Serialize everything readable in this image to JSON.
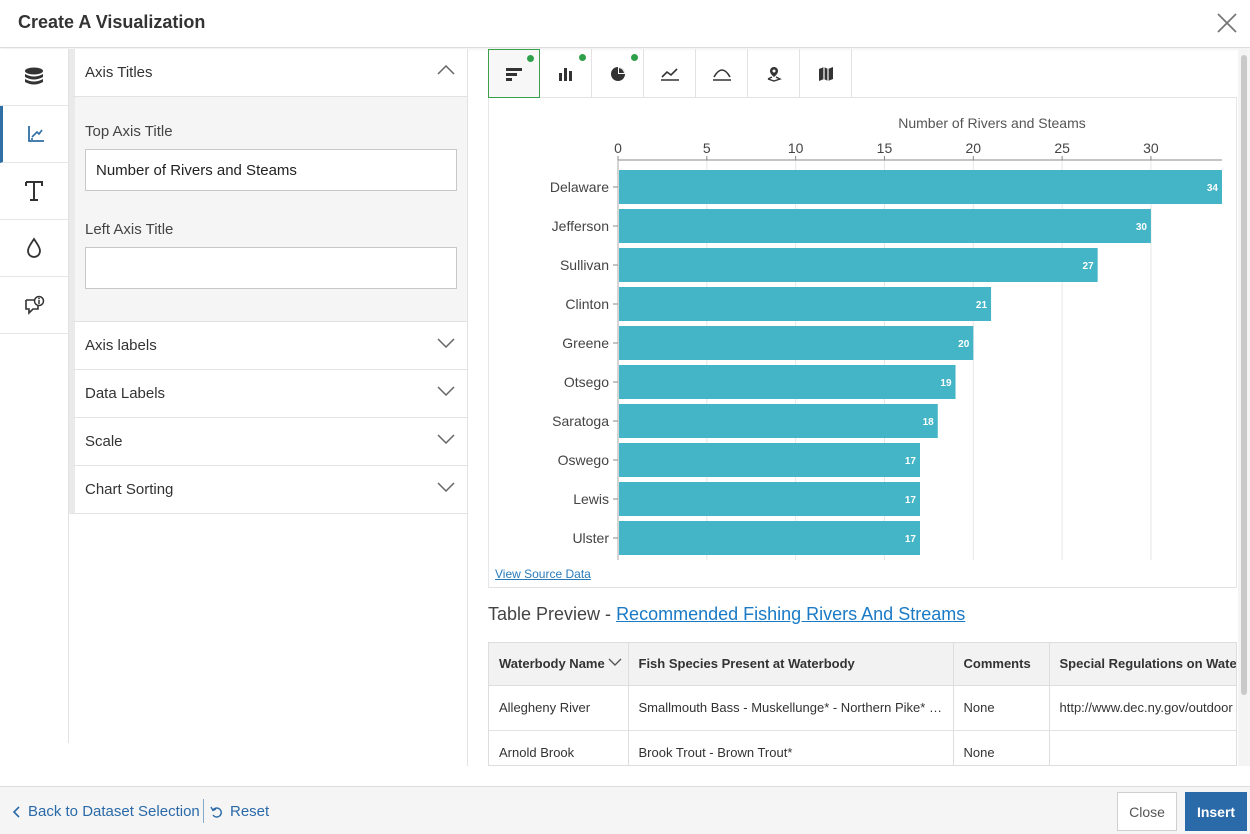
{
  "header": {
    "title": "Create A Visualization",
    "close_icon": "close-icon"
  },
  "rail": {
    "items": [
      {
        "icon": "database-icon",
        "active": false
      },
      {
        "icon": "chart-axis-icon",
        "active": true
      },
      {
        "icon": "text-icon",
        "active": false
      },
      {
        "icon": "color-drop-icon",
        "active": false
      },
      {
        "icon": "comment-info-icon",
        "active": false
      }
    ]
  },
  "panel": {
    "axis_titles": {
      "label": "Axis Titles",
      "top_axis_label": "Top Axis Title",
      "top_axis_value": "Number of Rivers and Steams",
      "left_axis_label": "Left Axis Title",
      "left_axis_value": ""
    },
    "sections": [
      "Axis labels",
      "Data Labels",
      "Scale",
      "Chart Sorting"
    ]
  },
  "toolbar": {
    "tools": [
      {
        "icon": "horizontal-bar-chart-icon",
        "active": true,
        "dot": true
      },
      {
        "icon": "column-chart-icon",
        "active": false,
        "dot": true
      },
      {
        "icon": "pie-chart-icon",
        "active": false,
        "dot": true
      },
      {
        "icon": "line-chart-icon",
        "active": false,
        "dot": false
      },
      {
        "icon": "area-chart-icon",
        "active": false,
        "dot": false
      },
      {
        "icon": "point-map-icon",
        "active": false,
        "dot": false
      },
      {
        "icon": "region-map-icon",
        "active": false,
        "dot": false
      }
    ],
    "dot_color": "#2ea04a"
  },
  "chart_data": {
    "type": "bar",
    "orientation": "horizontal",
    "title": "Number of Rivers and Steams",
    "categories": [
      "Delaware",
      "Jefferson",
      "Sullivan",
      "Clinton",
      "Greene",
      "Otsego",
      "Saratoga",
      "Oswego",
      "Lewis",
      "Ulster"
    ],
    "values": [
      34,
      30,
      27,
      21,
      20,
      19,
      18,
      17,
      17,
      17
    ],
    "ticks": [
      0,
      5,
      10,
      15,
      20,
      25,
      30
    ],
    "xlim": [
      0,
      34
    ],
    "axis_position": "top",
    "grid": true,
    "data_labels": true,
    "bar_color": "#44b5c6"
  },
  "source_link": "View Source Data",
  "table_preview": {
    "prefix": "Table Preview - ",
    "dataset": "Recommended Fishing Rivers And Streams",
    "columns": [
      "Waterbody Name",
      "Fish Species Present at Waterbody",
      "Comments",
      "Special Regulations on Waterbody"
    ],
    "rows": [
      [
        "Allegheny River",
        "Smallmouth Bass - Muskellunge* - Northern Pike* - Walleye",
        "None",
        "http://www.dec.ny.gov/outdoor"
      ],
      [
        "Arnold Brook",
        "Brook Trout - Brown Trout*",
        "None",
        ""
      ]
    ]
  },
  "footer": {
    "back_label": "Back to Dataset Selection",
    "reset_label": "Reset",
    "close_label": "Close",
    "insert_label": "Insert"
  }
}
